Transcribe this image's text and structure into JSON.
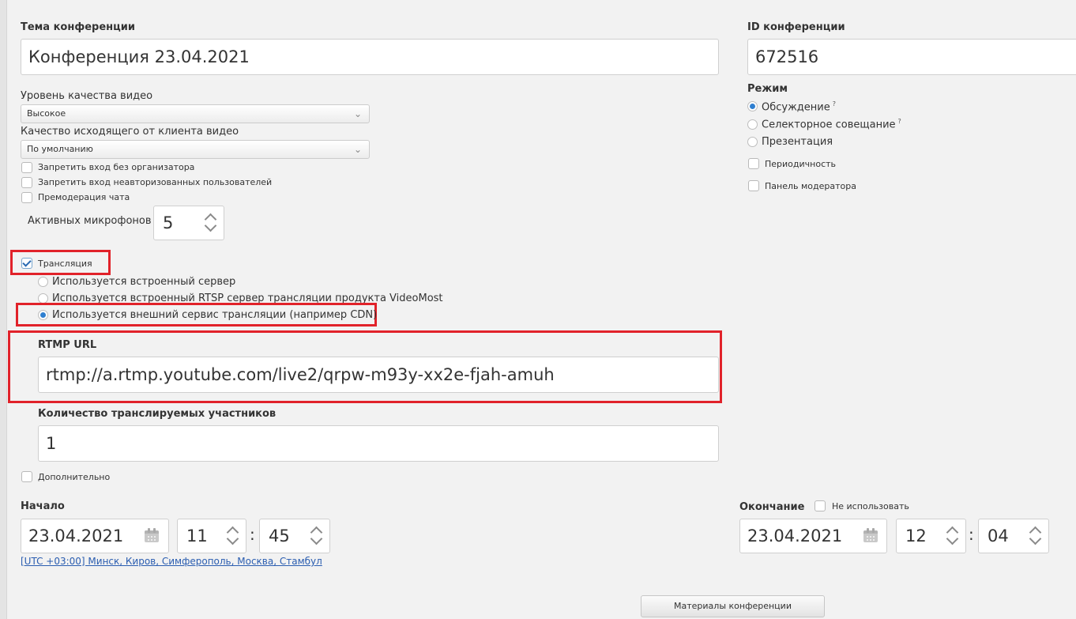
{
  "topic": {
    "label": "Тема конференции",
    "value": "Конференция 23.04.2021"
  },
  "conf_id": {
    "label": "ID конференции",
    "value": "672516"
  },
  "video_quality": {
    "label": "Уровень качества видео",
    "selected": "Высокое"
  },
  "outgoing_quality": {
    "label": "Качество исходящего от клиента видео",
    "selected": "По умолчанию"
  },
  "checkboxes": {
    "no_entry_without_organizer": {
      "label": "Запретить вход без организатора",
      "checked": false
    },
    "no_unauthorized": {
      "label": "Запретить вход неавторизованных пользователей",
      "checked": false
    },
    "chat_premoderation": {
      "label": "Премодерация чата",
      "checked": false
    }
  },
  "active_mics": {
    "label": "Активных микрофонов",
    "value": "5"
  },
  "mode": {
    "label": "Режим",
    "options": [
      {
        "label": "Обсуждение",
        "sup": "?",
        "selected": true
      },
      {
        "label": "Селекторное совещание",
        "sup": "?",
        "selected": false
      },
      {
        "label": "Презентация",
        "selected": false
      }
    ],
    "periodicity": {
      "label": "Периодичность",
      "checked": false
    },
    "moderator_panel": {
      "label": "Панель модератора",
      "checked": false
    }
  },
  "broadcast": {
    "label": "Трансляция",
    "checked": true,
    "options": [
      {
        "label": "Используется встроенный сервер",
        "selected": false
      },
      {
        "label": "Используется встроенный RTSP сервер трансляции продукта VideoMost",
        "selected": false
      },
      {
        "label": "Используется внешний сервис трансляции (например CDN)",
        "selected": true
      }
    ],
    "rtmp_label": "RTMP URL",
    "rtmp_value": "rtmp://a.rtmp.youtube.com/live2/qrpw-m93y-xx2e-fjah-amuh",
    "participants_label": "Количество транслируемых участников",
    "participants_value": "1"
  },
  "additional": {
    "label": "Дополнительно",
    "checked": false
  },
  "start": {
    "label": "Начало",
    "date": "23.04.2021",
    "hour": "11",
    "minute": "45",
    "timezone": "[UTC +03:00] Минск, Киров, Симферополь, Москва, Стамбул"
  },
  "end": {
    "label": "Окончание",
    "not_use_label": "Не использовать",
    "date": "23.04.2021",
    "hour": "12",
    "minute": "04"
  },
  "materials_button": "Материалы конференции",
  "colors": {
    "highlight": "#e1222a",
    "radio_selected": "#2f7fd0",
    "link": "#2a5db0"
  },
  "separator": ":"
}
